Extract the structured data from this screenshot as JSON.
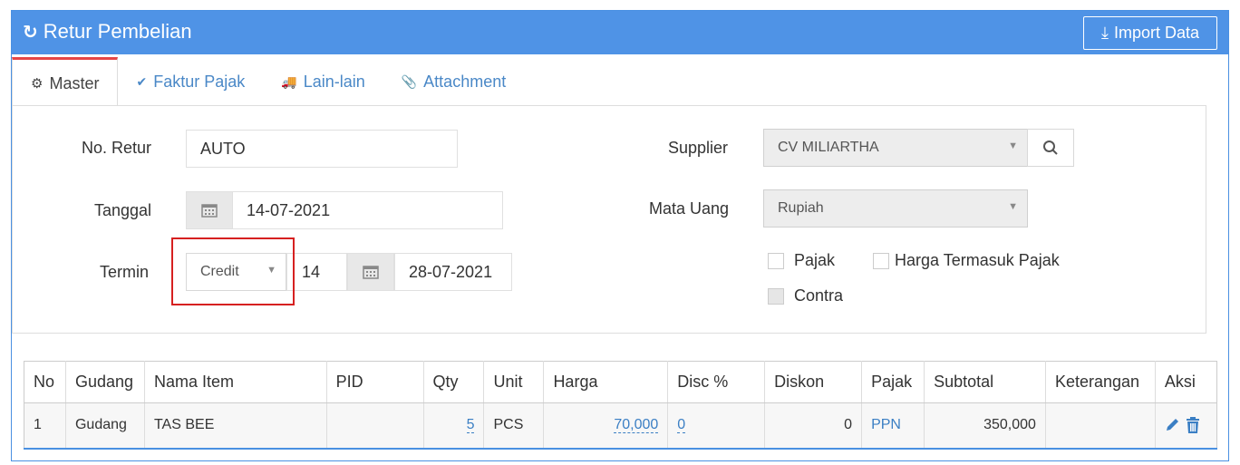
{
  "header": {
    "title": "Retur Pembelian",
    "refresh_icon": "↻",
    "import_label": "Import Data",
    "import_icon": "⤓"
  },
  "tabs": [
    {
      "label": "Master",
      "icon": "⚙"
    },
    {
      "label": "Faktur Pajak",
      "icon": "✔"
    },
    {
      "label": "Lain-lain",
      "icon": "🚚"
    },
    {
      "label": "Attachment",
      "icon": "📎"
    }
  ],
  "form": {
    "no_retur": {
      "label": "No. Retur",
      "value": "AUTO"
    },
    "tanggal": {
      "label": "Tanggal",
      "value": "14-07-2021"
    },
    "termin": {
      "label": "Termin",
      "type": "Credit",
      "days": "14",
      "due_date": "28-07-2021"
    },
    "supplier": {
      "label": "Supplier",
      "value": "CV MILIARTHA"
    },
    "mata_uang": {
      "label": "Mata Uang",
      "value": "Rupiah"
    },
    "checkboxes": {
      "pajak": "Pajak",
      "harga_termasuk_pajak": "Harga Termasuk Pajak",
      "contra": "Contra"
    }
  },
  "table": {
    "columns": [
      "No",
      "Gudang",
      "Nama Item",
      "PID",
      "Qty",
      "Unit",
      "Harga",
      "Disc %",
      "Diskon",
      "Pajak",
      "Subtotal",
      "Keterangan",
      "Aksi"
    ],
    "rows": [
      {
        "no": "1",
        "gudang": "Gudang",
        "nama_item": "TAS BEE",
        "pid": "",
        "qty": "5",
        "unit": "PCS",
        "harga": "70,000",
        "disc": "0",
        "diskon": "0",
        "pajak": "PPN",
        "subtotal": "350,000",
        "keterangan": ""
      }
    ]
  }
}
